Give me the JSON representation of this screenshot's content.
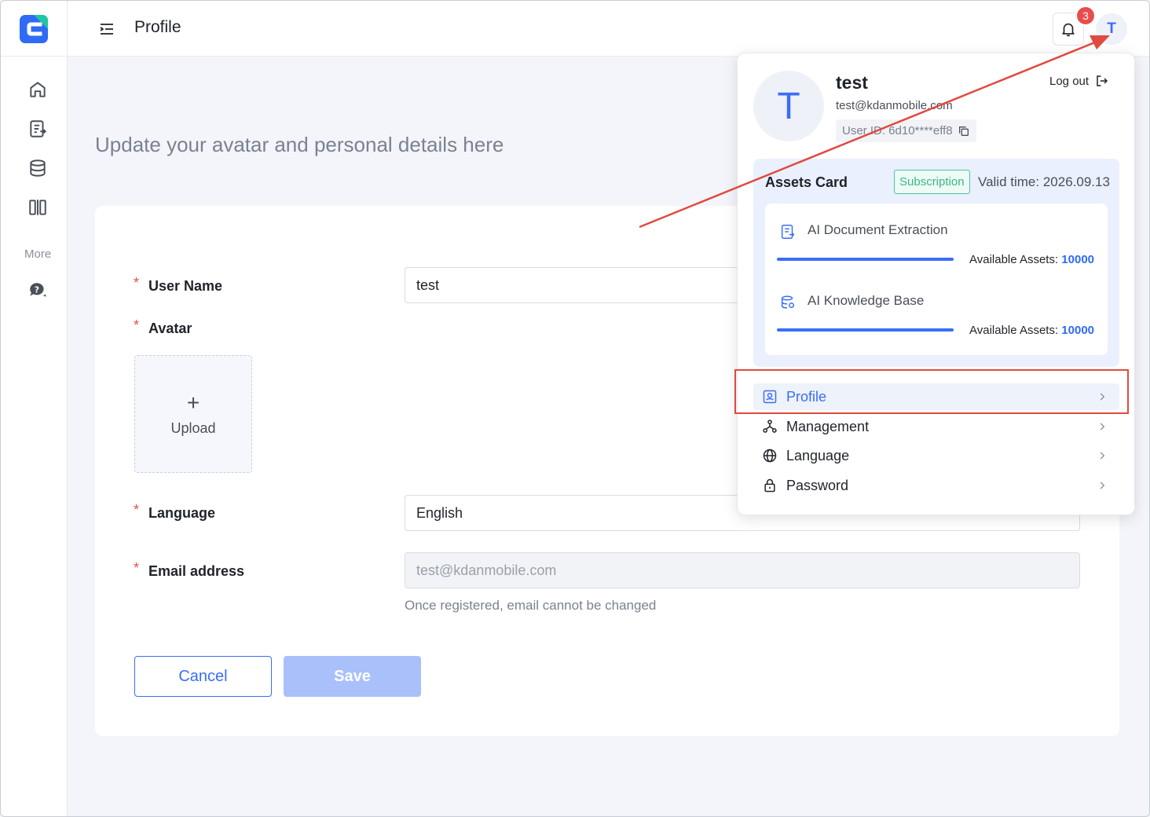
{
  "header": {
    "title": "Profile",
    "notification_count": "3",
    "avatar_initial": "T"
  },
  "sidebar": {
    "more_label": "More",
    "icons": [
      "home-icon",
      "document-icon",
      "database-icon",
      "compare-icon",
      "help-chat-icon"
    ]
  },
  "main": {
    "subtitle": "Update your avatar and personal details here",
    "form": {
      "user_name_label": "User Name",
      "user_name_value": "test",
      "avatar_label": "Avatar",
      "upload_label": "Upload",
      "language_label": "Language",
      "language_value": "English",
      "email_label": "Email address",
      "email_value": "test@kdanmobile.com",
      "email_hint": "Once registered, email cannot be changed",
      "cancel_label": "Cancel",
      "save_label": "Save"
    }
  },
  "dropdown": {
    "avatar_initial": "T",
    "name": "test",
    "email": "test@kdanmobile.com",
    "user_id": "User ID: 6d10****eff8",
    "logout_label": "Log out",
    "assets": {
      "title": "Assets Card",
      "subscription_tag": "Subscription",
      "valid_time": "Valid time: 2026.09.13",
      "items": [
        {
          "label": "AI Document Extraction",
          "available_label": "Available Assets:",
          "available_value": "10000"
        },
        {
          "label": "AI Knowledge Base",
          "available_label": "Available Assets:",
          "available_value": "10000"
        }
      ]
    },
    "menu": [
      {
        "label": "Profile",
        "icon": "profile-icon"
      },
      {
        "label": "Management",
        "icon": "management-icon"
      },
      {
        "label": "Language",
        "icon": "globe-icon"
      },
      {
        "label": "Password",
        "icon": "lock-icon"
      }
    ]
  },
  "colors": {
    "accent": "#3b6ef5",
    "annotation": "#e04a3f",
    "badge": "#e84d4d",
    "subscription": "#3bb888"
  }
}
